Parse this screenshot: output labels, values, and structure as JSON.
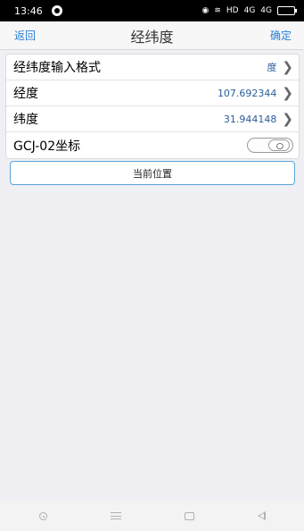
{
  "status_bar": {
    "time": "13:46",
    "network_label": "HD",
    "signal_1": "4G",
    "signal_2": "4G"
  },
  "nav": {
    "back_label": "返回",
    "title": "经纬度",
    "confirm_label": "确定"
  },
  "settings": {
    "rows": [
      {
        "label": "经纬度输入格式",
        "value": "度"
      },
      {
        "label": "经度",
        "value": "107.692344"
      },
      {
        "label": "纬度",
        "value": "31.944148"
      },
      {
        "label": "GCJ-02坐标",
        "toggle_on": false
      }
    ]
  },
  "current_position_label": "当前位置",
  "colors": {
    "accent": "#2a7fd4",
    "value_text": "#2b5d9a",
    "button_border": "#5aa5d6",
    "background": "#efeff4"
  },
  "icons": {
    "chevron": "chevron-right-icon",
    "toggle": "toggle-switch"
  }
}
